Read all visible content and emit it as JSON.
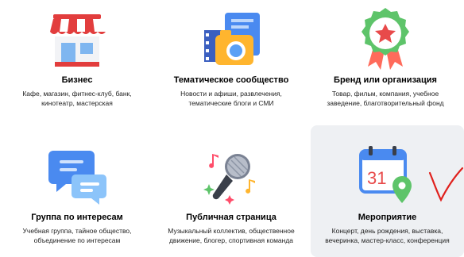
{
  "cards": [
    {
      "title": "Бизнес",
      "desc1": "Кафе, магазин, фитнес-клуб, банк,",
      "desc2": "кинотеатр, мастерская",
      "icon": "storefront-icon"
    },
    {
      "title": "Тематическое сообщество",
      "desc1": "Новости и афиши, развлечения,",
      "desc2": "тематические блоги и СМИ",
      "icon": "photo-newspaper-icon"
    },
    {
      "title": "Бренд или организация",
      "desc1": "Товар, фильм, компания, учебное",
      "desc2": "заведение, благотворительный фонд",
      "icon": "award-badge-icon"
    },
    {
      "title": "Группа по интересам",
      "desc1": "Учебная группа, тайное общество,",
      "desc2": "объединение по интересам",
      "icon": "chat-bubbles-icon"
    },
    {
      "title": "Публичная страница",
      "desc1": "Музыкальный коллектив, общественное",
      "desc2": "движение, блогер, спортивная команда",
      "icon": "microphone-icon"
    },
    {
      "title": "Мероприятие",
      "desc1": "Концерт, день рождения, выставка,",
      "desc2": "вечеринка, мастер-класс, конференция",
      "icon": "calendar-pin-icon",
      "selected": true,
      "calendar_day": "31"
    }
  ],
  "annotation_color": "#e0201c",
  "accent": "#4a8af0"
}
